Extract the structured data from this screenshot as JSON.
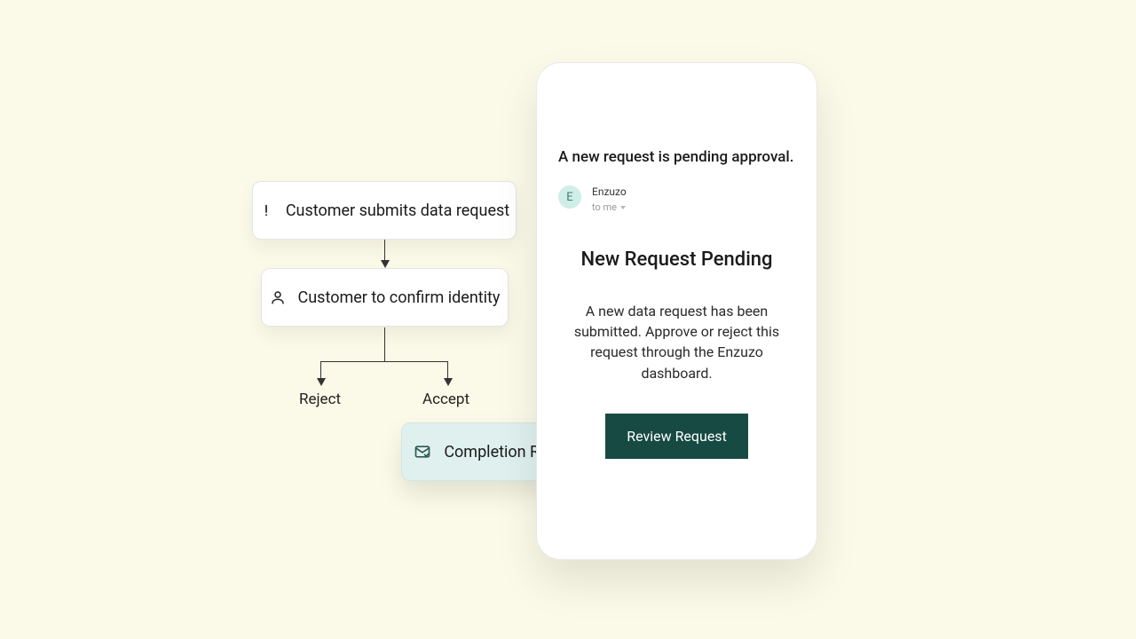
{
  "flow": {
    "node1": {
      "label": "Customer submits data request"
    },
    "node2": {
      "label": "Customer to confirm identity"
    },
    "rejectLabel": "Reject",
    "acceptLabel": "Accept",
    "node3": {
      "label": "Completion Reply"
    }
  },
  "email": {
    "subject": "A new request is pending approval.",
    "sender": {
      "avatarInitial": "E",
      "name": "Enzuzo",
      "toLine": "to me"
    },
    "title": "New Request Pending",
    "body": "A new data request has been submitted. Approve or reject this request through the Enzuzo dashboard.",
    "buttonLabel": "Review Request"
  },
  "colors": {
    "background": "#fbf9e7",
    "cardBg": "#ffffff",
    "accentTeal": "#164a42",
    "completionBg": "#dff0ee",
    "avatarBg": "#cfeee8"
  }
}
